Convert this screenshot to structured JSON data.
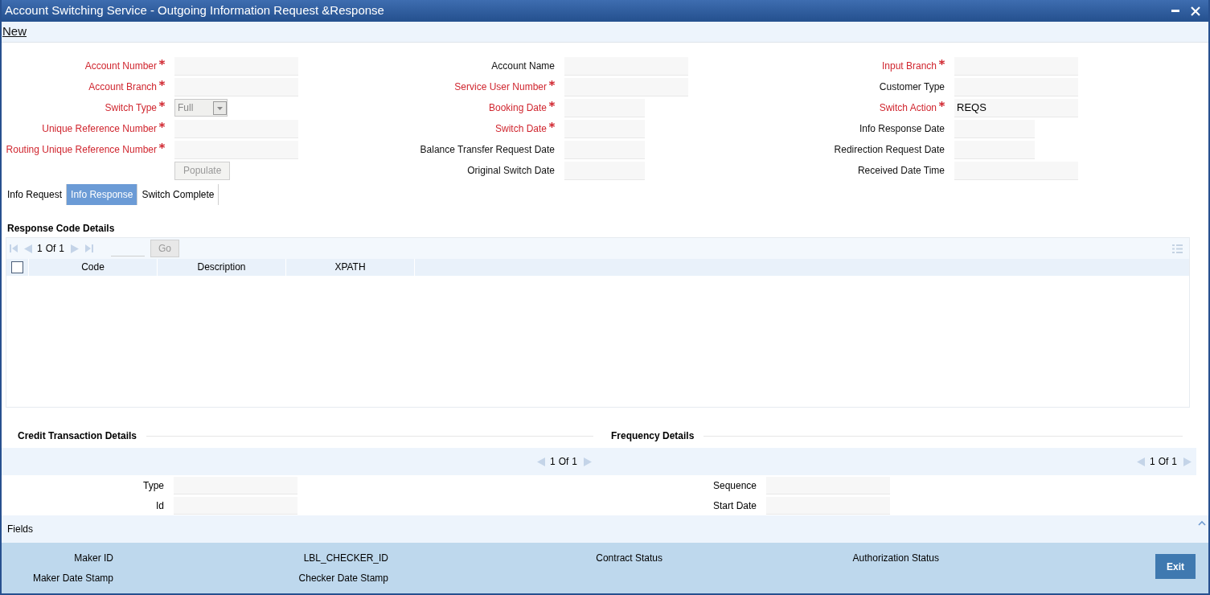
{
  "window": {
    "title": "Account Switching Service - Outgoing Information Request &Response"
  },
  "toolbar": {
    "link": "New"
  },
  "form": {
    "columns": [
      [
        {
          "kind": "text",
          "label": "Account Number",
          "required": true
        },
        {
          "kind": "text",
          "label": "Account Branch",
          "required": true
        },
        {
          "kind": "select",
          "label": "Switch Type",
          "required": true,
          "value": "Full",
          "disabled": true
        },
        {
          "kind": "text",
          "label": "Unique Reference Number",
          "required": true
        },
        {
          "kind": "text",
          "label": "Routing Unique Reference Number",
          "required": true
        },
        {
          "kind": "button",
          "label": "Populate",
          "disabled": true
        }
      ],
      [
        {
          "kind": "text",
          "label": "Account Name",
          "required": false
        },
        {
          "kind": "text",
          "label": "Service User Number",
          "required": true
        },
        {
          "kind": "date",
          "label": "Booking Date",
          "required": true
        },
        {
          "kind": "date",
          "label": "Switch Date",
          "required": true
        },
        {
          "kind": "date",
          "label": "Balance Transfer Request Date",
          "required": false
        },
        {
          "kind": "date",
          "label": "Original Switch Date",
          "required": false
        }
      ],
      [
        {
          "kind": "text",
          "label": "Input Branch",
          "required": true
        },
        {
          "kind": "text",
          "label": "Customer Type",
          "required": false
        },
        {
          "kind": "text",
          "label": "Switch Action",
          "required": true,
          "value": "REQS"
        },
        {
          "kind": "date",
          "label": "Info Response Date",
          "required": false
        },
        {
          "kind": "date",
          "label": "Redirection Request Date",
          "required": false
        },
        {
          "kind": "text",
          "label": "Received Date Time",
          "required": false
        }
      ]
    ]
  },
  "tabs": [
    {
      "label": "Info Request",
      "selected": false
    },
    {
      "label": "Info Response",
      "selected": true
    },
    {
      "label": "Switch Complete",
      "selected": false
    }
  ],
  "response_grid": {
    "title": "Response Code Details",
    "pager": {
      "current": "1",
      "of": "Of",
      "total": "1"
    },
    "go": "Go",
    "select_all_checked": false,
    "columns": [
      "Code",
      "Description",
      "XPATH"
    ]
  },
  "credit_section": {
    "title": "Credit Transaction Details",
    "pager": {
      "current": "1",
      "of": "Of",
      "total": "1"
    },
    "fields": [
      "Type",
      "Id"
    ]
  },
  "frequency_section": {
    "title": "Frequency Details",
    "pager": {
      "current": "1",
      "of": "Of",
      "total": "1"
    },
    "fields": [
      "Sequence",
      "Start Date"
    ]
  },
  "fields_bar": {
    "label": "Fields"
  },
  "audit": {
    "items": [
      [
        "Maker ID",
        "Maker Date Stamp"
      ],
      [
        "LBL_CHECKER_ID",
        "Checker Date Stamp"
      ],
      [
        "Contract Status"
      ],
      [
        "Authorization Status"
      ]
    ],
    "exit": "Exit"
  }
}
